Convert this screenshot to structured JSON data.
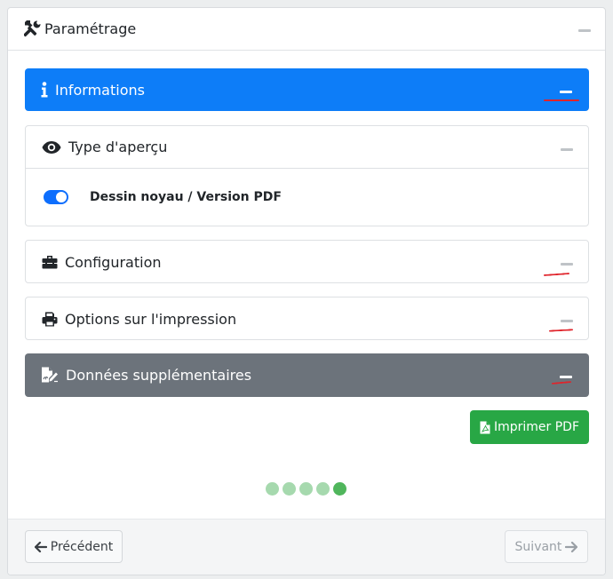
{
  "panel": {
    "title": "Paramétrage",
    "icon": "tools-icon"
  },
  "cards": {
    "informations": {
      "title": "Informations",
      "icon": "info-icon",
      "color": "#0d7df8"
    },
    "type_apercu": {
      "title": "Type d'aperçu",
      "icon": "eye-icon",
      "toggle": {
        "label": "Dessin noyau / Version PDF",
        "checked": true
      }
    },
    "configuration": {
      "title": "Configuration",
      "icon": "toolbox-icon"
    },
    "options_impression": {
      "title": "Options sur l'impression",
      "icon": "printer-icon"
    },
    "donnees_supplementaires": {
      "title": "Données supplémentaires",
      "icon": "file-signature-icon",
      "color": "#6c737b"
    }
  },
  "actions": {
    "print_pdf": {
      "label": "Imprimer PDF",
      "icon": "file-pdf-icon",
      "color": "#28a745"
    }
  },
  "stepper": {
    "total": 5,
    "current": 5
  },
  "footer": {
    "previous_label": "Précédent",
    "next_label": "Suivant"
  },
  "annotation_color": "#e0242b"
}
